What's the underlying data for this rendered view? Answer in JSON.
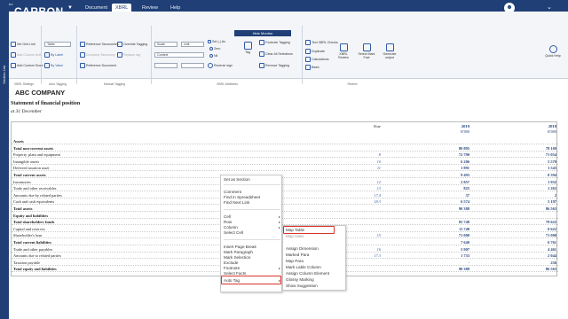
{
  "app": {
    "logo_prefix": "ez",
    "logo": "CARBON",
    "tagline": "THE SPACE FOR QUALITY DATA",
    "tabs": [
      "Document",
      "XBRL",
      "Review",
      "Help"
    ],
    "active_tab": "XBRL",
    "hide_monitor": "Hide Monitor",
    "colors": {
      "brand": "#1f3f76",
      "accent": "#2d5aa8",
      "highlight": "#d9342b"
    }
  },
  "ribbon": {
    "xbrl_settings": {
      "grid_unit": "Set Grid Unit",
      "add_custom_unit": "Add Custom Unit",
      "add_custom_scale": "Add Custom Scale",
      "group": "XBRL Settings"
    },
    "auto_tagging": {
      "table_select": "Table",
      "by_label": "By Label",
      "by_value": "By Value",
      "group": "Auto Tagging"
    },
    "manual_tagging": {
      "reference_taxonomies": "Reference Taxonomies",
      "company_taxonomy": "Company Taxonomy",
      "reference_document": "Reference Document",
      "override_tagging": "Override Tagging",
      "replace_tag": "Replace tag",
      "group": "Manual Tagging"
    },
    "xbrl_attributes": {
      "scale": "Scale",
      "unit": "Unit",
      "context": "Context",
      "set_as": "Set (-) As",
      "zero": "Zero",
      "nil": "Nil",
      "reverse_sign": "Reverse sign",
      "tag": "Tag",
      "footnote_tagging": "Footnote Tagging",
      "clear_all_selections": "Clear All Selections",
      "remove_tagging": "Remove Tagging",
      "group": "XBRL Attributes"
    },
    "review": {
      "text_xbrl_checks": "Text XBRL Checks",
      "duplicate": "Duplicate",
      "calculations": "Calculations",
      "basic": "Basic",
      "xbrl_review": "XBRL Review",
      "select_mark_fact": "Select Mark Fact",
      "generate_output": "Generate output",
      "group": "Review"
    },
    "quick_help": "Quick Help"
  },
  "sidebar": {
    "label": "Section List"
  },
  "document": {
    "company": "ABC COMPANY",
    "title": "Statement of financial position",
    "date": "at 31 December",
    "table": {
      "note_header": "Note",
      "year_1": "2019",
      "year_2": "2018",
      "unit_1": "R'000",
      "unit_2": "R'000",
      "rows": [
        {
          "label": "Assets",
          "bold": true,
          "note": "",
          "v1": "",
          "v2": ""
        },
        {
          "label": "Total non-current assets",
          "bold": true,
          "note": "",
          "v1": "80 895",
          "v2": "78 169"
        },
        {
          "label": "Property, plant and equipment",
          "bold": false,
          "note": "8",
          "v1": "72 790",
          "v2": "71 054"
        },
        {
          "label": "Intangible assets",
          "bold": false,
          "note": "10",
          "v1": "6 206",
          "v2": "5 578"
        },
        {
          "label": "Deferred taxation asset",
          "bold": false,
          "note": "11",
          "v1": "1 891",
          "v2": "1 543"
        },
        {
          "label": "Total current assets",
          "bold": true,
          "note": "",
          "v1": "9 493",
          "v2": "8 394"
        },
        {
          "label": "Inventories",
          "bold": false,
          "note": "12",
          "v1": "2 857",
          "v2": "1 932"
        },
        {
          "label": "Trade and other receivables",
          "bold": false,
          "note": "13",
          "v1": "825",
          "v2": "1 263"
        },
        {
          "label": "Amounts due by related parties",
          "bold": false,
          "note": "17.4",
          "v1": "37",
          "v2": "2"
        },
        {
          "label": "Cash and cash equivalents",
          "bold": false,
          "note": "18.3",
          "v1": "6 574",
          "v2": "5 197"
        },
        {
          "label": "Total assets",
          "bold": true,
          "note": "",
          "v1": "90 388",
          "v2": "86 563"
        },
        {
          "label": "Equity and liabilities",
          "bold": true,
          "note": "",
          "v1": "",
          "v2": ""
        },
        {
          "label": "Total shareholders funds",
          "bold": true,
          "note": "",
          "v1": "82 748",
          "v2": "79 622"
        },
        {
          "label": "Capital and reserves",
          "bold": false,
          "note": "",
          "v1": "11 748",
          "v2": "8 622"
        },
        {
          "label": "Shareholder's loan",
          "bold": false,
          "note": "15",
          "v1": "71 000",
          "v2": "71 000"
        },
        {
          "label": "Total current liabilities",
          "bold": true,
          "note": "",
          "v1": "7 640",
          "v2": "6 761"
        },
        {
          "label": "Trade and other payables",
          "bold": false,
          "note": "16",
          "v1": "5 907",
          "v2": "4 461"
        },
        {
          "label": "Amounts due to related parties",
          "bold": false,
          "note": "17.3",
          "v1": "1 733",
          "v2": "2 044"
        },
        {
          "label": "Taxation payable",
          "bold": false,
          "note": "",
          "v1": "-",
          "v2": "256"
        },
        {
          "label": "Total equity and liabilities",
          "bold": true,
          "note": "",
          "v1": "90 388",
          "v2": "86 563"
        }
      ]
    }
  },
  "context_menu": {
    "items": [
      "Set as Section",
      "Comment",
      "Find in Spreadsheet",
      "Find Next Link",
      "Cell",
      "Row",
      "Column",
      "Select Cell",
      "Insert Page Break",
      "Mark Paragraph",
      "Mark Selection",
      "Exclude",
      "Footnote",
      "Select Facts",
      "Auto Tag"
    ],
    "submenu": [
      "Map Table",
      "Map Data",
      "Assign Dimension",
      "Marked Para",
      "Map Para",
      "Mark Lable Column",
      "Assign Column Element",
      "Glossy Marking",
      "Show Suggestion"
    ]
  }
}
